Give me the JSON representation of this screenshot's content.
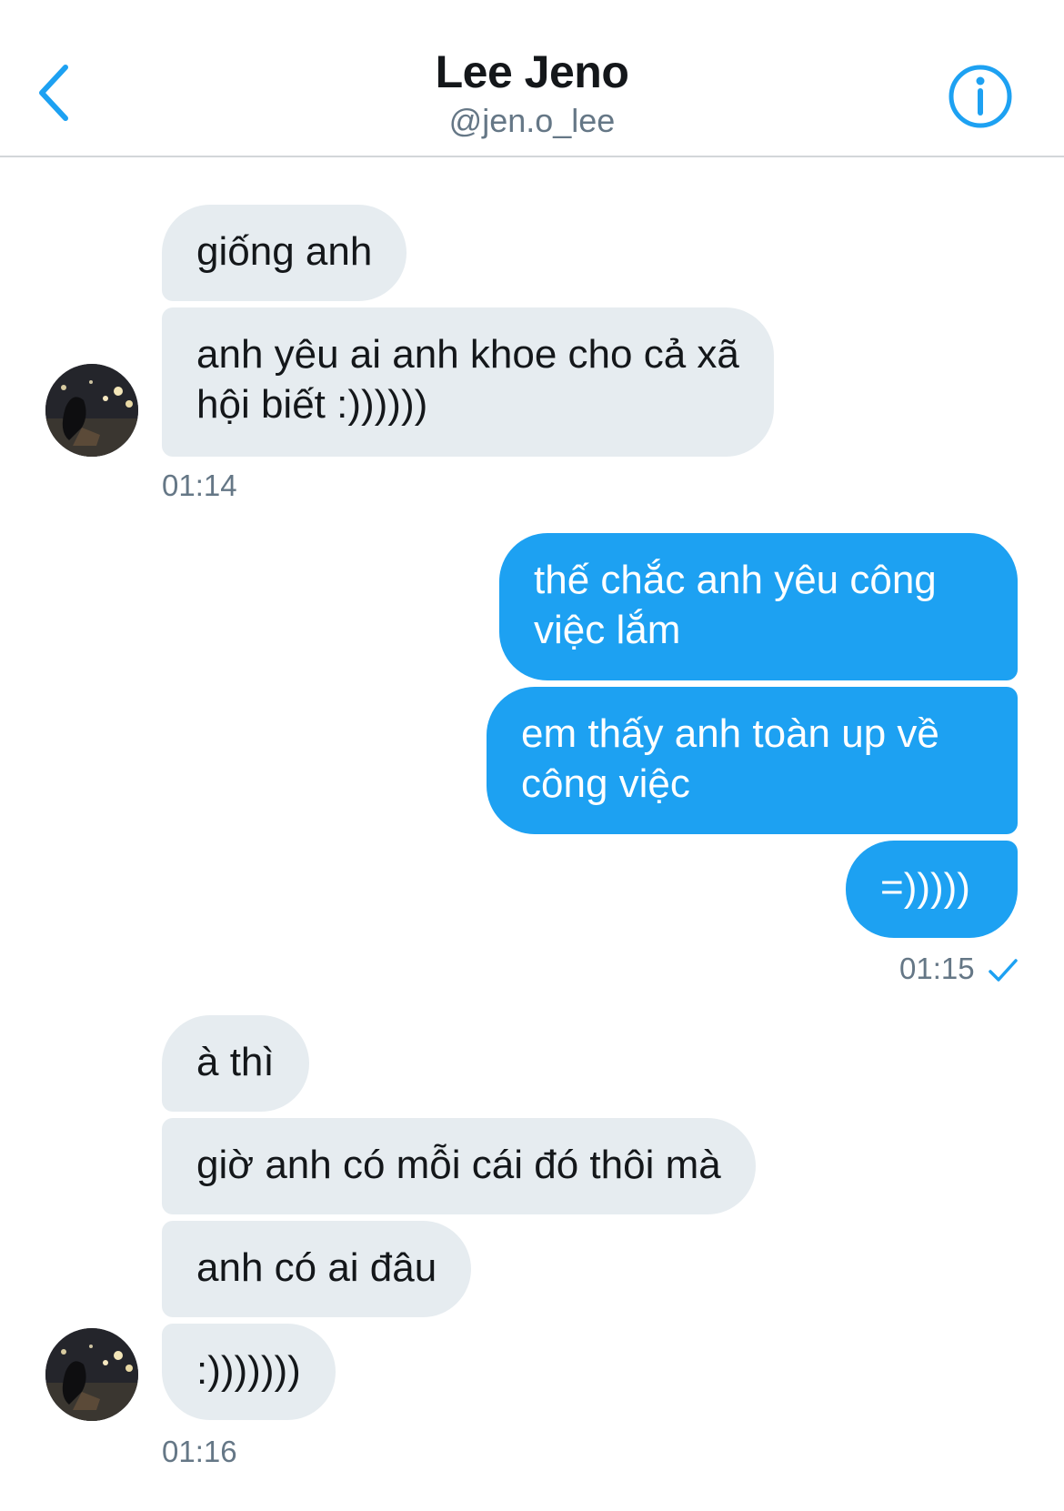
{
  "header": {
    "contact_name": "Lee Jeno",
    "contact_handle": "@jen.o_lee",
    "back_icon": "chevron-left-icon",
    "info_icon": "info-circle-icon",
    "accent_color": "#1da1f2"
  },
  "messages": [
    {
      "direction": "incoming",
      "text_lines": [
        "giống anh"
      ]
    },
    {
      "direction": "incoming",
      "text_lines": [
        "anh yêu ai anh khoe cho cả xã",
        "hội biết :))))))"
      ]
    },
    {
      "direction": "outgoing",
      "text_lines": [
        "thế chắc anh yêu công",
        "việc lắm"
      ]
    },
    {
      "direction": "outgoing",
      "text_lines": [
        "em thấy anh toàn up về",
        "công việc"
      ]
    },
    {
      "direction": "outgoing",
      "text_lines": [
        "=)))))"
      ]
    },
    {
      "direction": "incoming",
      "text_lines": [
        "à thì"
      ]
    },
    {
      "direction": "incoming",
      "text_lines": [
        "giờ anh có mỗi cái đó thôi mà"
      ]
    },
    {
      "direction": "incoming",
      "text_lines": [
        "anh có ai đâu"
      ]
    },
    {
      "direction": "incoming",
      "text_lines": [
        ":)))))))"
      ]
    }
  ],
  "timestamps": {
    "group1": "01:14",
    "group2": "01:15",
    "group3": "01:16"
  },
  "read_receipt_icon": "checkmark-icon",
  "colors": {
    "incoming_bubble": "#e6ecf0",
    "outgoing_bubble": "#1da1f2",
    "secondary_text": "#657786"
  }
}
